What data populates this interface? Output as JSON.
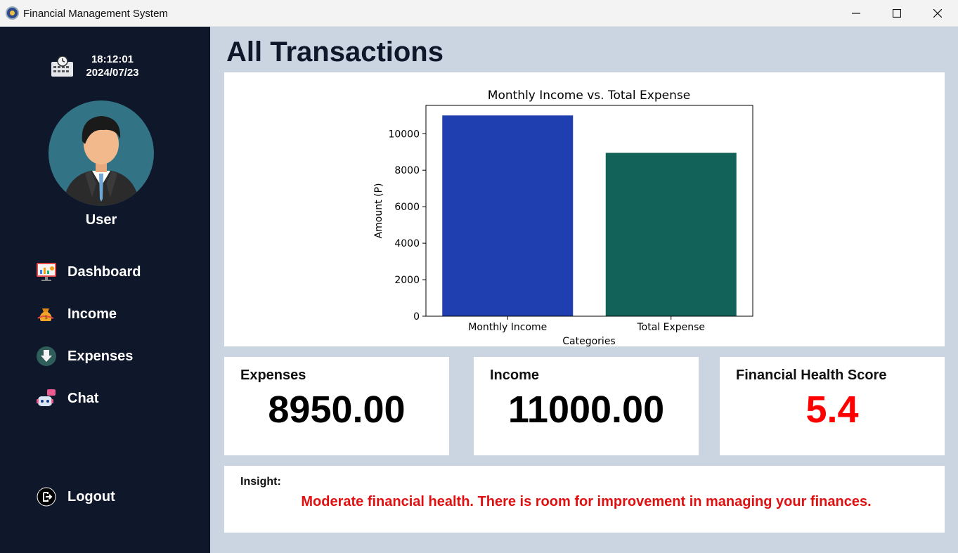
{
  "window": {
    "title": "Financial Management System"
  },
  "sidebar": {
    "time": "18:12:01",
    "date": "2024/07/23",
    "user_name": "User",
    "nav": [
      {
        "label": "Dashboard",
        "icon": "dashboard-icon"
      },
      {
        "label": "Income",
        "icon": "money-bag-icon"
      },
      {
        "label": "Expenses",
        "icon": "download-icon"
      },
      {
        "label": "Chat",
        "icon": "chatbot-icon"
      }
    ],
    "logout_label": "Logout"
  },
  "main": {
    "title": "All Transactions",
    "cards": {
      "expenses_label": "Expenses",
      "expenses_value": "8950.00",
      "income_label": "Income",
      "income_value": "11000.00",
      "score_label": "Financial Health Score",
      "score_value": "5.4"
    },
    "insight": {
      "label": "Insight:",
      "text": "Moderate financial health. There is room for improvement in managing your finances."
    }
  },
  "colors": {
    "sidebar_bg": "#0f172a",
    "page_bg": "#cbd5e1",
    "score_color": "#ff0000",
    "insight_color": "#e01010"
  },
  "chart_data": {
    "type": "bar",
    "title": "Monthly Income vs. Total Expense",
    "xlabel": "Categories",
    "ylabel": "Amount (P)",
    "categories": [
      "Monthly Income",
      "Total Expense"
    ],
    "values": [
      11000,
      8950
    ],
    "colors": [
      "#1f3fb0",
      "#12625a"
    ],
    "ylim": [
      0,
      11550
    ],
    "yticks": [
      0,
      2000,
      4000,
      6000,
      8000,
      10000
    ],
    "grid": false
  }
}
